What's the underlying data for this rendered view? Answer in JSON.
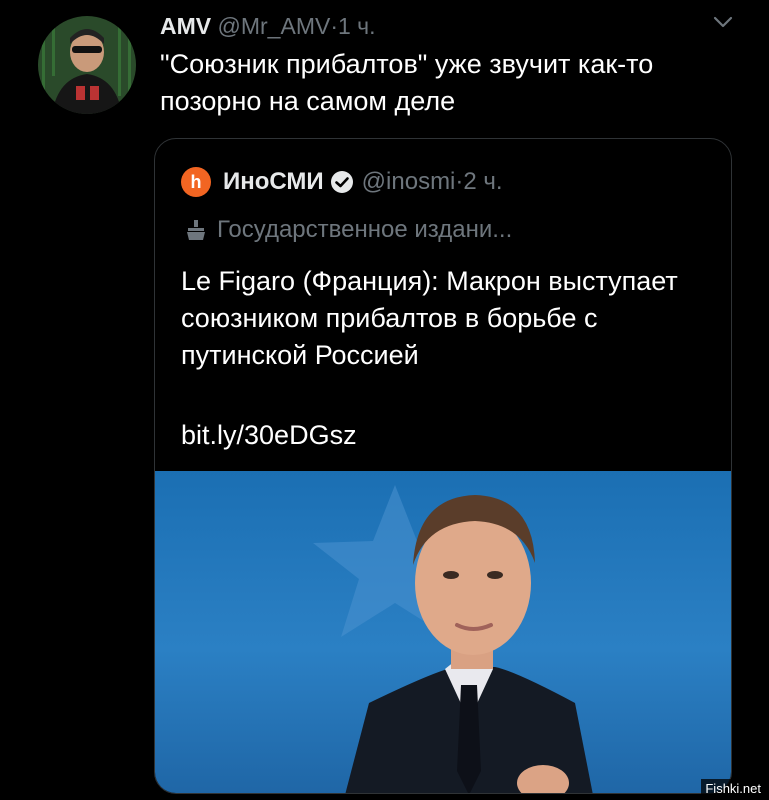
{
  "tweet": {
    "author_name": "AMV",
    "handle": "@Mr_AMV",
    "separator": "·",
    "time": "1 ч.",
    "text": "\"Союзник прибалтов\" уже звучит как-то позорно на самом деле",
    "menu_icon": "chevron-down-icon"
  },
  "quote": {
    "author_name": "ИноСМИ",
    "handle": "@inosmi",
    "separator": "·",
    "time": "2 ч.",
    "label": "Государственное издани...",
    "text": "Le Figaro (Франция): Макрон выступает союзником прибалтов в борьбе с путинской Россией",
    "link": "bit.ly/30eDGsz",
    "logo_letter": "h",
    "logo_color": "#f26522"
  },
  "watermark": "Fishki.net",
  "colors": {
    "background": "#000000",
    "text": "#ffffff",
    "muted": "#6e767d",
    "border": "#2f3336",
    "photo_blue": "#2b80c4"
  }
}
